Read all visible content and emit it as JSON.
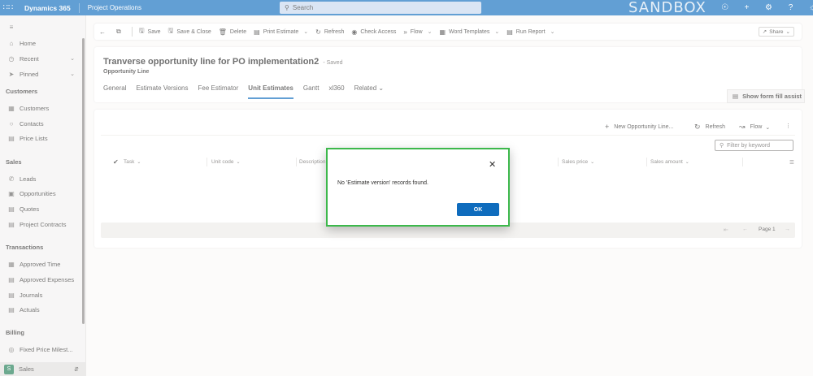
{
  "topbar": {
    "brand": "Dynamics 365",
    "app": "Project Operations",
    "search_placeholder": "Search",
    "environment": "SANDBOX",
    "icons": [
      "lightbulb-icon",
      "plus-icon",
      "settings-icon",
      "help-icon",
      "copilot-icon"
    ]
  },
  "sidebar": {
    "top_items": [
      {
        "label": "Home",
        "icon": "home-icon"
      },
      {
        "label": "Recent",
        "icon": "clock-icon"
      },
      {
        "label": "Pinned",
        "icon": "pin-icon"
      }
    ],
    "groups": [
      {
        "title": "Customers",
        "items": [
          {
            "label": "Customers",
            "icon": "building-icon"
          },
          {
            "label": "Contacts",
            "icon": "person-icon"
          },
          {
            "label": "Price Lists",
            "icon": "document-icon"
          }
        ]
      },
      {
        "title": "Sales",
        "items": [
          {
            "label": "Leads",
            "icon": "phone-icon"
          },
          {
            "label": "Opportunities",
            "icon": "clipboard-icon"
          },
          {
            "label": "Quotes",
            "icon": "quote-icon"
          },
          {
            "label": "Project Contracts",
            "icon": "contract-icon"
          }
        ]
      },
      {
        "title": "Transactions",
        "items": [
          {
            "label": "Approved Time",
            "icon": "calendar-icon"
          },
          {
            "label": "Approved Expenses",
            "icon": "receipt-icon"
          },
          {
            "label": "Journals",
            "icon": "journal-icon"
          },
          {
            "label": "Actuals",
            "icon": "document-icon"
          }
        ]
      },
      {
        "title": "Billing",
        "items": [
          {
            "label": "Fixed Price Milest...",
            "icon": "milestone-icon"
          }
        ]
      }
    ],
    "area": {
      "badge": "S",
      "label": "Sales"
    }
  },
  "commands": [
    {
      "label": "Save",
      "icon": "save-icon"
    },
    {
      "label": "Save & Close",
      "icon": "save-close-icon"
    },
    {
      "label": "Delete",
      "icon": "delete-icon"
    },
    {
      "label": "Print Estimate",
      "icon": "print-icon",
      "dropdown": true
    },
    {
      "label": "Refresh",
      "icon": "refresh-icon"
    },
    {
      "label": "Check Access",
      "icon": "check-access-icon"
    },
    {
      "label": "Flow",
      "icon": "flow-icon",
      "dropdown": true
    },
    {
      "label": "Word Templates",
      "icon": "word-icon",
      "dropdown": true
    },
    {
      "label": "Run Report",
      "icon": "report-icon",
      "dropdown": true
    }
  ],
  "share_label": "Share",
  "record": {
    "title": "Tranverse opportunity line for PO implementation2",
    "saved_status": "- Saved",
    "entity": "Opportunity Line"
  },
  "tabs": [
    {
      "label": "General",
      "active": false
    },
    {
      "label": "Estimate Versions",
      "active": false
    },
    {
      "label": "Fee Estimator",
      "active": false
    },
    {
      "label": "Unit Estimates",
      "active": true
    },
    {
      "label": "Gantt",
      "active": false
    },
    {
      "label": "xl360",
      "active": false
    },
    {
      "label": "Related",
      "active": false
    }
  ],
  "fill_assist_label": "Show form fill assist",
  "grid": {
    "toolbar": {
      "new_label": "New Opportunity Line...",
      "refresh_label": "Refresh",
      "flow_label": "Flow"
    },
    "filter_placeholder": "Filter by keyword",
    "columns": [
      "Task",
      "Unit code",
      "Description",
      "Sales price",
      "Sales amount"
    ],
    "page_label": "Page 1"
  },
  "dialog": {
    "message": "No 'Estimate version' records found.",
    "ok_label": "OK"
  }
}
